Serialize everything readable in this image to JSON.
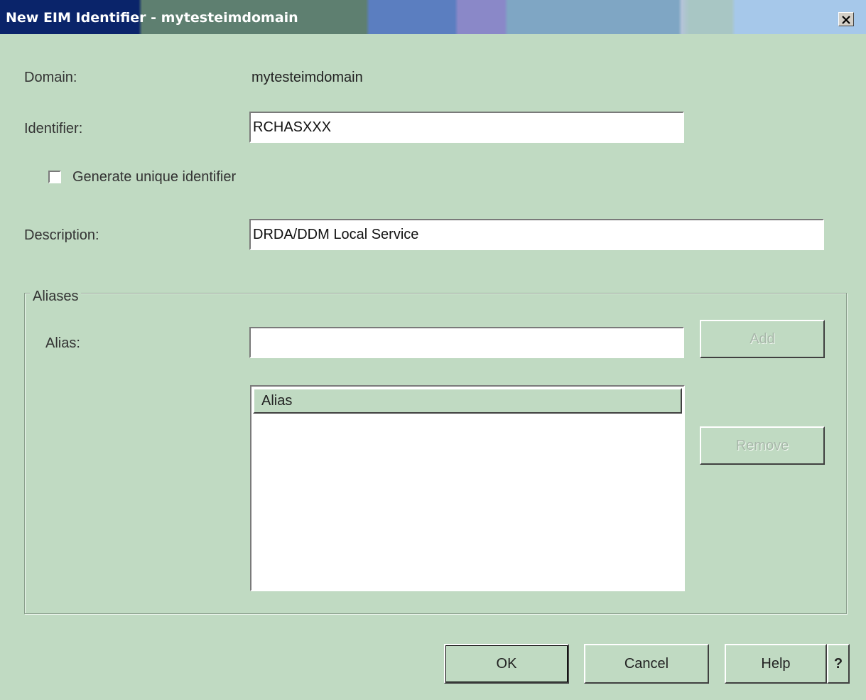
{
  "window": {
    "title": "New EIM Identifier - mytesteimdomain",
    "close_glyph": "×"
  },
  "form": {
    "domain_label": "Domain:",
    "domain_value": "mytesteimdomain",
    "identifier_label": "Identifier:",
    "identifier_value": "RCHASXXX",
    "generate_unique_label": "Generate unique identifier",
    "generate_unique_checked": false,
    "description_label": "Description:",
    "description_value": "DRDA/DDM Local Service"
  },
  "aliases": {
    "group_title": "Aliases",
    "alias_label": "Alias:",
    "alias_value": "",
    "add_label": "Add",
    "remove_label": "Remove",
    "list_column_header": "Alias",
    "items": []
  },
  "buttons": {
    "ok_label": "OK",
    "cancel_label": "Cancel",
    "help_label": "Help",
    "whats_this_label": "?"
  },
  "colors": {
    "background": "#c0dac2",
    "title_text": "#ffffff",
    "disabled_text": "#a8b8aa"
  }
}
